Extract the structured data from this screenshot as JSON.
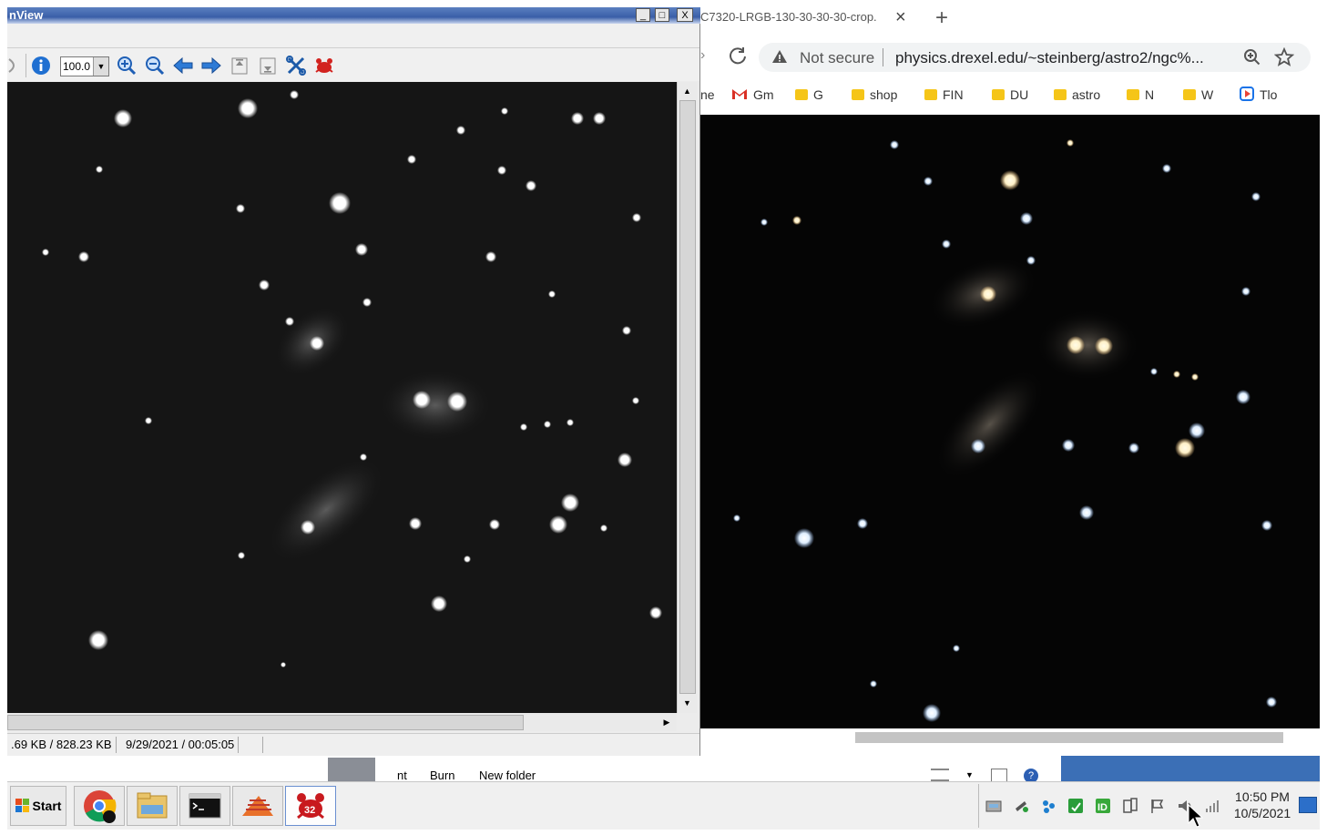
{
  "irfanview": {
    "title": "nView",
    "window_controls": {
      "minimize": "_",
      "maximize": "□",
      "close": "X"
    },
    "zoom_value": "100.0",
    "toolbar_icons": [
      "info-icon",
      "zoom-in-icon",
      "zoom-out-icon",
      "previous-arrow-icon",
      "next-arrow-icon",
      "first-page-icon",
      "last-page-icon",
      "settings-tools-icon",
      "irfanview-logo-icon"
    ],
    "status": {
      "size": ".69 KB / 828.23 KB",
      "date": "9/29/2021 / 00:05:05"
    }
  },
  "chrome": {
    "tab_title": "C7320-LRGB-130-30-30-30-crop.",
    "tab_close": "×",
    "new_tab": "+",
    "not_secure": "Not secure",
    "url": "physics.drexel.edu/~steinberg/astro2/ngc%...",
    "bookmarks": [
      {
        "label": "ne",
        "type": "text"
      },
      {
        "label": "Gm",
        "type": "gmail"
      },
      {
        "label": "G",
        "type": "folder"
      },
      {
        "label": "shop",
        "type": "folder"
      },
      {
        "label": "FIN",
        "type": "folder"
      },
      {
        "label": "DU",
        "type": "folder"
      },
      {
        "label": "astro",
        "type": "folder"
      },
      {
        "label": "N",
        "type": "folder"
      },
      {
        "label": "W",
        "type": "folder"
      },
      {
        "label": "Tlo",
        "type": "video"
      }
    ]
  },
  "explorer": {
    "items": [
      "nt",
      "Burn",
      "New folder"
    ]
  },
  "taskbar": {
    "start_label": "Start",
    "apps": [
      "chrome-icon",
      "file-explorer-icon",
      "command-prompt-icon",
      "matlab-icon",
      "irfanview-icon"
    ],
    "irfan_badge": "32",
    "clock_time": "10:50 PM",
    "clock_date": "10/5/2021"
  },
  "colors": {
    "title_blue": "#3a5fa8",
    "taskbar_accent": "#3b6fb6"
  }
}
